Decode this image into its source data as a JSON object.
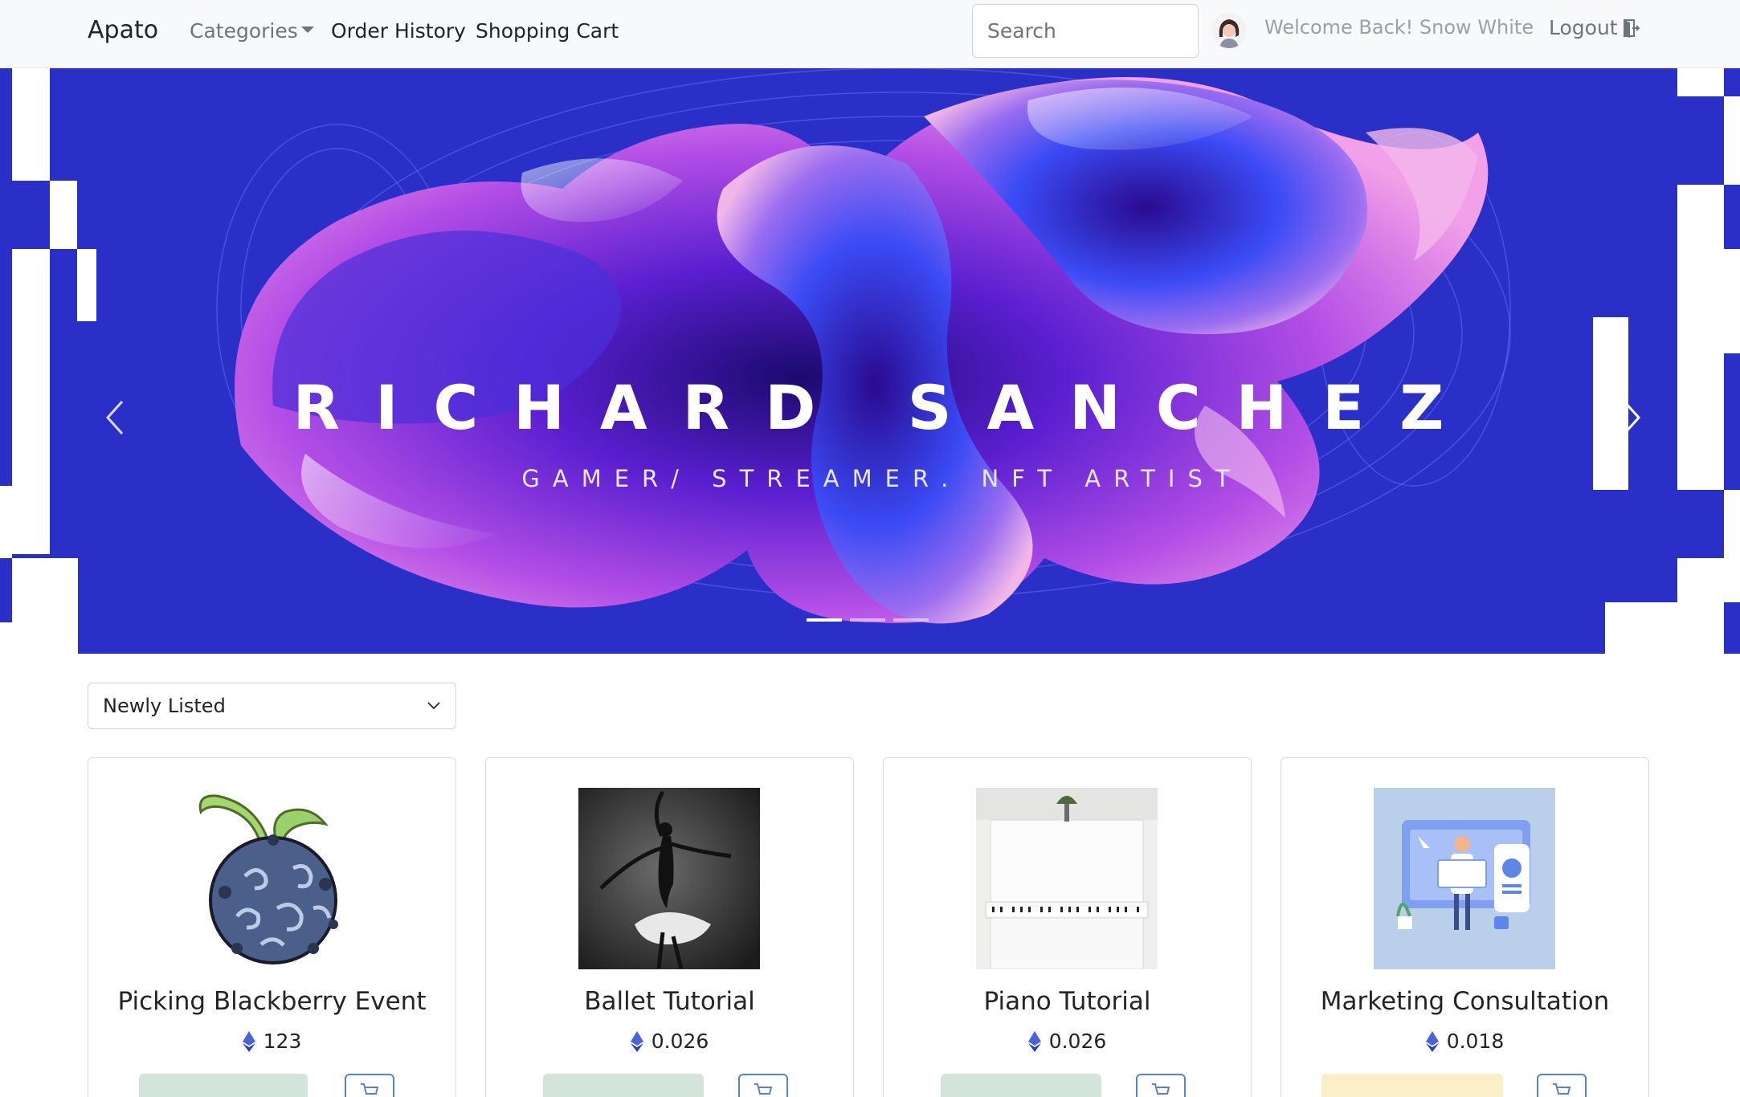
{
  "navbar": {
    "brand": "Apato",
    "categories_label": "Categories",
    "order_history_label": "Order History",
    "shopping_cart_label": "Shopping Cart",
    "search_placeholder": "Search",
    "welcome_text": "Welcome Back! Snow White",
    "logout_label": "Logout"
  },
  "carousel": {
    "title": "RICHARD SANCHEZ",
    "subtitle": "GAMER/ STREAMER. NFT ARTIST",
    "slide_count": 3,
    "active_slide": 1,
    "colors": {
      "background": "#2a2fc8",
      "accent": "#b040e0"
    }
  },
  "sort": {
    "selected": "Newly Listed"
  },
  "products": [
    {
      "title": "Picking Blackberry Event",
      "price": "123",
      "image_icon": "devil-fruit-icon",
      "button_color": "#d3e5da"
    },
    {
      "title": "Ballet Tutorial",
      "price": "0.026",
      "image_icon": "ballet-dancer-image",
      "button_color": "#d3e5da"
    },
    {
      "title": "Piano Tutorial",
      "price": "0.026",
      "image_icon": "piano-image",
      "button_color": "#d3e5da"
    },
    {
      "title": "Marketing Consultation",
      "price": "0.018",
      "image_icon": "marketing-illustration-image",
      "button_color": "#fbefc9"
    }
  ]
}
